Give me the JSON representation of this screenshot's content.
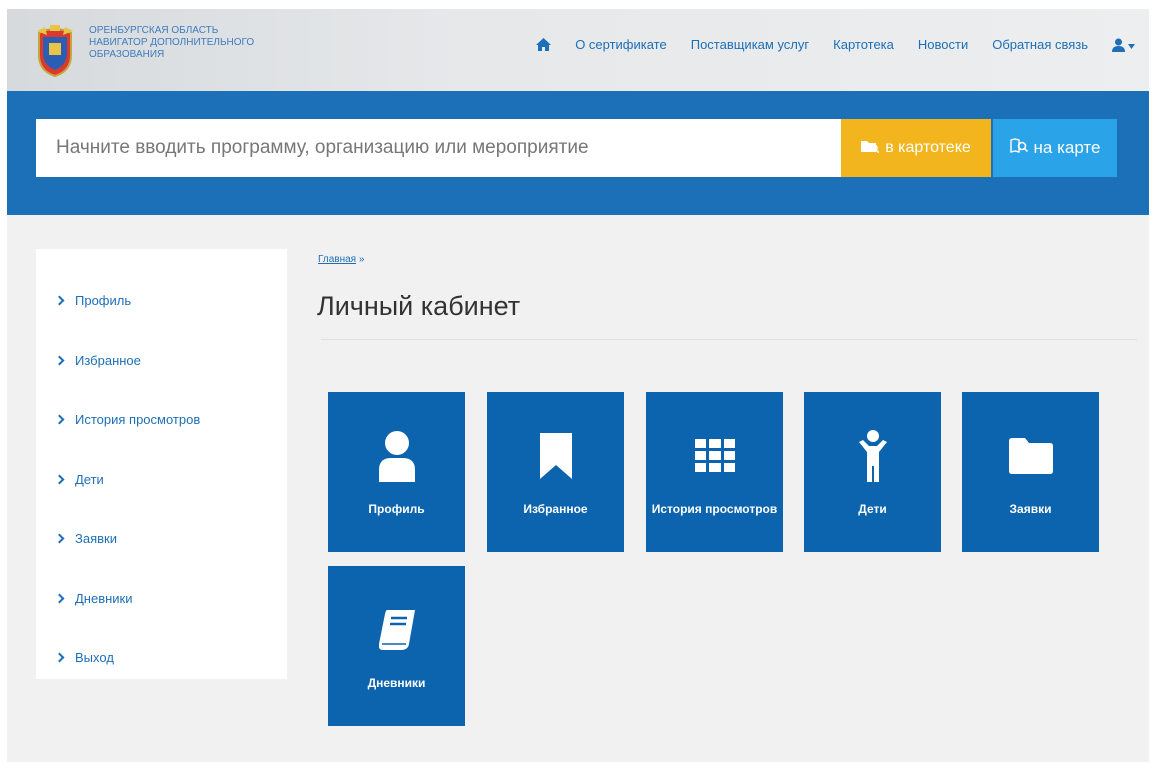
{
  "header": {
    "logo_lines": [
      "ОРЕНБУРГСКАЯ ОБЛАСТЬ",
      "НАВИГАТОР ДОПОЛНИТЕЛЬНОГО",
      "ОБРАЗОВАНИЯ"
    ],
    "nav": [
      {
        "label": "О сертификате"
      },
      {
        "label": "Поставщикам услуг"
      },
      {
        "label": "Картотека"
      },
      {
        "label": "Новости"
      },
      {
        "label": "Обратная связь"
      }
    ]
  },
  "search": {
    "placeholder": "Начните вводить программу, организацию или мероприятие",
    "catalog_button": "в картотеке",
    "map_button": "на карте"
  },
  "sidebar": {
    "items": [
      {
        "label": "Профиль"
      },
      {
        "label": "Избранное"
      },
      {
        "label": "История просмотров"
      },
      {
        "label": "Дети"
      },
      {
        "label": "Заявки"
      },
      {
        "label": "Дневники"
      },
      {
        "label": "Выход"
      }
    ]
  },
  "main": {
    "breadcrumb": "Главная",
    "breadcrumb_sep": "»",
    "title": "Личный кабинет",
    "tiles": [
      {
        "label": "Профиль",
        "icon": "user-icon"
      },
      {
        "label": "Избранное",
        "icon": "bookmark-icon"
      },
      {
        "label": "История просмотров",
        "icon": "grid-icon"
      },
      {
        "label": "Дети",
        "icon": "child-icon"
      },
      {
        "label": "Заявки",
        "icon": "folder-icon"
      },
      {
        "label": "Дневники",
        "icon": "book-icon"
      }
    ]
  },
  "colors": {
    "brand_blue": "#1c70b8",
    "tile_blue": "#0b64ad",
    "catalog_yellow": "#f3b51d",
    "map_light_blue": "#2aa3e8",
    "link_blue": "#1e6fb5"
  }
}
